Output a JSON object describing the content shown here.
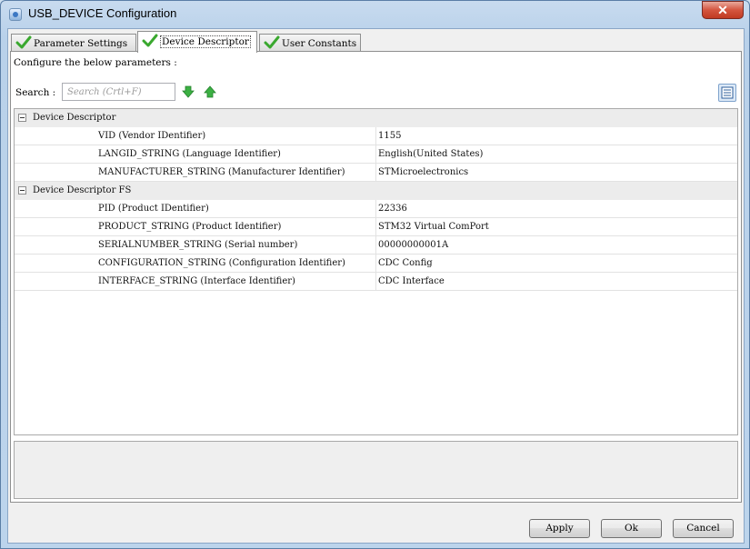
{
  "window": {
    "title": "USB_DEVICE Configuration",
    "close_glyph": "✕"
  },
  "tabs": [
    {
      "label": "Parameter Settings",
      "icon": "green-check-icon",
      "active": false
    },
    {
      "label": "Device Descriptor",
      "icon": "green-check-icon",
      "active": true
    },
    {
      "label": "User Constants",
      "icon": "green-check-icon",
      "active": false
    }
  ],
  "panel": {
    "instruction": "Configure the below parameters :",
    "search_label": "Search :",
    "search_placeholder": "Search (Crtl+F)",
    "search_down_icon": "green-arrow-down-icon",
    "search_up_icon": "green-arrow-up-icon",
    "view_toggle_icon": "list-view-icon"
  },
  "groups": [
    {
      "name": "Device Descriptor",
      "params": [
        {
          "name": "VID (Vendor IDentifier)",
          "value": "1155"
        },
        {
          "name": "LANGID_STRING (Language Identifier)",
          "value": "English(United States)"
        },
        {
          "name": "MANUFACTURER_STRING (Manufacturer Identifier)",
          "value": "STMicroelectronics"
        }
      ]
    },
    {
      "name": "Device Descriptor FS",
      "params": [
        {
          "name": "PID (Product IDentifier)",
          "value": "22336"
        },
        {
          "name": "PRODUCT_STRING (Product Identifier)",
          "value": "STM32 Virtual ComPort"
        },
        {
          "name": "SERIALNUMBER_STRING (Serial number)",
          "value": "00000000001A"
        },
        {
          "name": "CONFIGURATION_STRING (Configuration Identifier)",
          "value": "CDC Config"
        },
        {
          "name": "INTERFACE_STRING (Interface Identifier)",
          "value": "CDC Interface"
        }
      ]
    }
  ],
  "buttons": {
    "apply": "Apply",
    "ok": "Ok",
    "cancel": "Cancel"
  },
  "colors": {
    "check_green": "#3aa82f",
    "arrow_green": "#3cb043",
    "window_frame": "#b9d1ea",
    "close_red": "#c8452c"
  }
}
